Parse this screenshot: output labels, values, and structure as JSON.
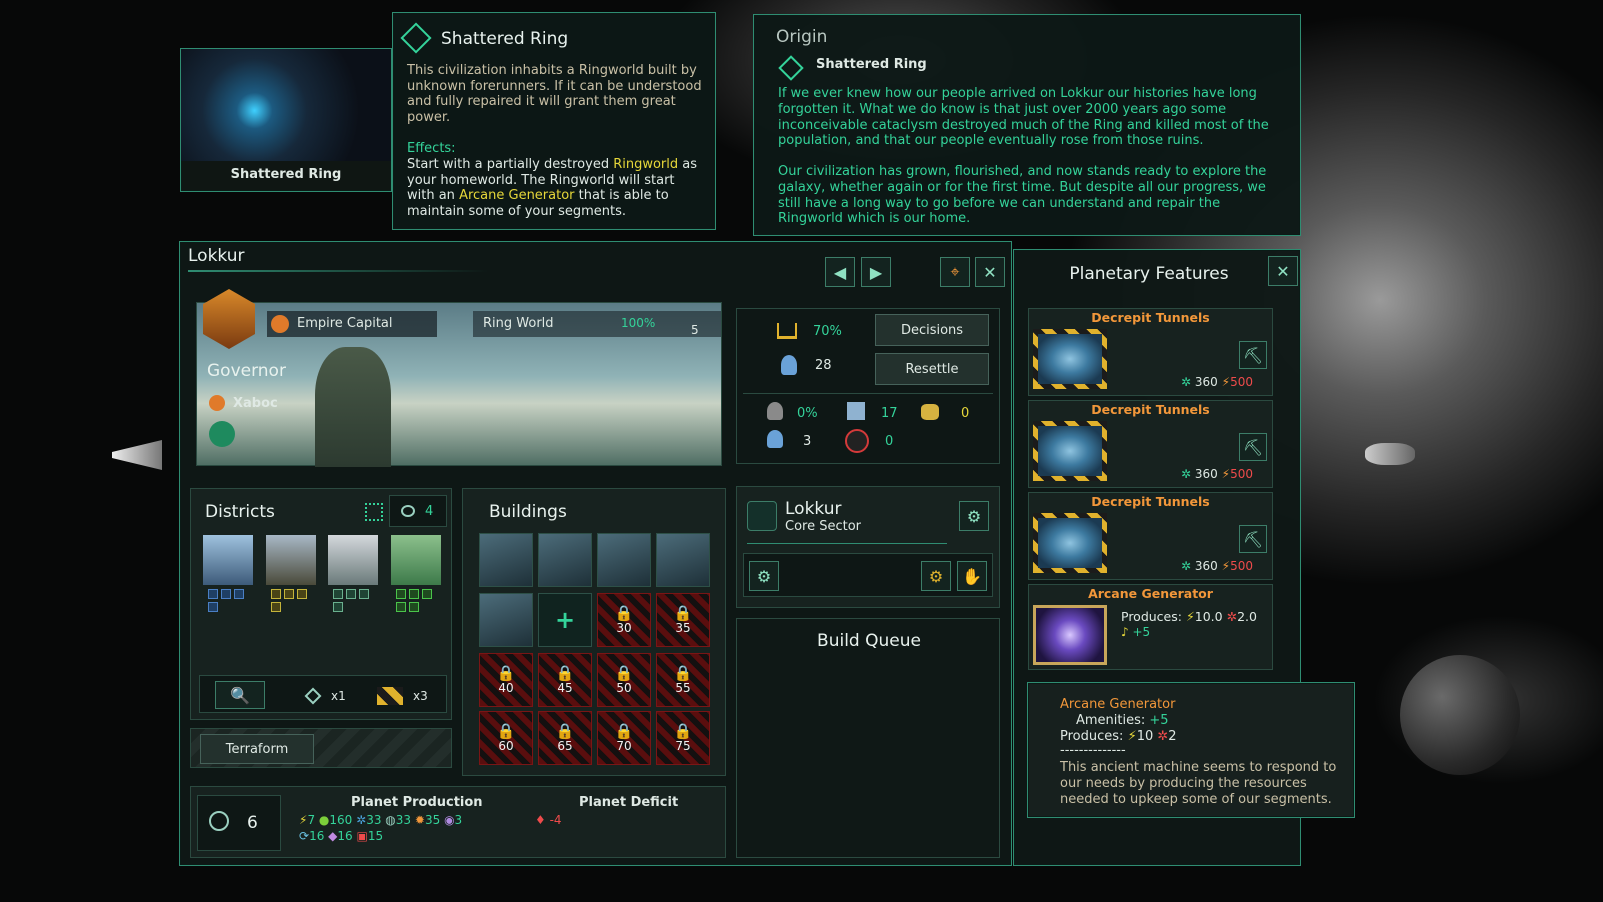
{
  "origin_card": {
    "image_label": "Shattered Ring",
    "title": "Shattered Ring",
    "description": "This civilization inhabits a Ringworld built by unknown forerunners. If it can be understood and fully repaired it will grant them great power.",
    "effects_label": "Effects:",
    "effects_1": "Start with a partially destroyed ",
    "ringworld_link": "Ringworld",
    "effects_2": " as your homeworld. The Ringworld will start with an ",
    "arcane_link": "Arcane Generator",
    "effects_3": " that is able to maintain some of your segments."
  },
  "origin_tooltip": {
    "header": "Origin",
    "name": "Shattered Ring",
    "para1": "If we ever knew how our people arrived on Lokkur our histories have long forgotten it. What we do know is that just over 2000 years ago some inconceivable cataclysm destroyed much of the Ring and killed most of the population, and that our people eventually rose from those ruins.",
    "para2": "Our civilization has grown, flourished, and now stands ready to explore the galaxy, whether again or for the first time. But despite all our progress, we still have a long way to go before we can understand and repair the Ringworld which is our home."
  },
  "planet": {
    "name": "Lokkur",
    "capital_label": "Empire Capital",
    "type_label": "Ring World",
    "habitability": "100%",
    "size": "5",
    "governor_label": "Governor",
    "governor_name": "Xaboc"
  },
  "stats": {
    "stability": "70%",
    "pops": "28",
    "decisions_label": "Decisions",
    "resettle_label": "Resettle",
    "unemployment": "0%",
    "housing": "17",
    "amenities": "0",
    "free_jobs": "3",
    "crime": "0"
  },
  "districts": {
    "title": "Districts",
    "slots": "4",
    "deposits_x1": "x1",
    "blockers_x3": "x3",
    "terraform_label": "Terraform"
  },
  "buildings": {
    "title": "Buildings",
    "locked_levels": [
      "30",
      "35",
      "40",
      "45",
      "50",
      "55",
      "60",
      "65",
      "70",
      "75"
    ]
  },
  "sector": {
    "name": "Lokkur",
    "subtitle": "Core Sector"
  },
  "build_queue": {
    "title": "Build Queue"
  },
  "production": {
    "pop_growth": "6",
    "title": "Planet Production",
    "deficit_title": "Planet Deficit",
    "energy": "7",
    "food": "160",
    "minerals": "33",
    "alloys_a": "33",
    "goods": "35",
    "unity": "3",
    "research": "16",
    "crystals": "16",
    "consumer": "15",
    "deficit": "-4"
  },
  "features": {
    "title": "Planetary Features",
    "items": [
      {
        "name": "Decrepit Tunnels",
        "cost_a": "360",
        "cost_b": "500"
      },
      {
        "name": "Decrepit Tunnels",
        "cost_a": "360",
        "cost_b": "500"
      },
      {
        "name": "Decrepit Tunnels",
        "cost_a": "360",
        "cost_b": "500"
      }
    ],
    "generator": {
      "name": "Arcane Generator",
      "produces_label": "Produces:",
      "energy": "10.0",
      "minerals": "2.0",
      "amenities": "+5"
    }
  },
  "generator_tooltip": {
    "name": "Arcane Generator",
    "amenities_label": "Amenities:",
    "amenities": "+5",
    "produces_label": "Produces:",
    "energy": "10",
    "minerals": "2",
    "separator": "--------------",
    "description": "This ancient machine seems to respond to our needs by producing the resources needed to upkeep some of our segments."
  },
  "colors": {
    "accent": "#2f8d72",
    "highlight": "#34d39a",
    "warning": "#f2973a",
    "link": "#e6d73a",
    "danger": "#ee4b4b"
  }
}
